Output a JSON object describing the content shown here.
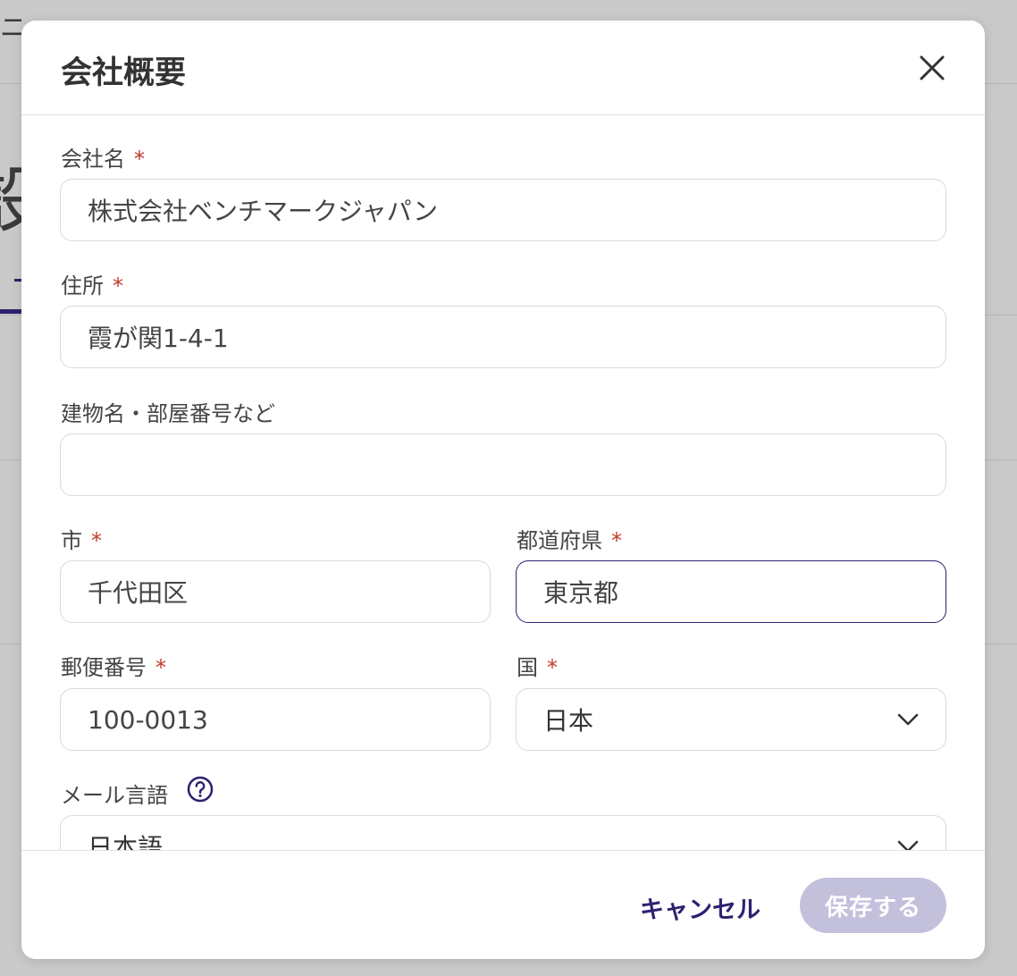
{
  "background": {
    "topbar_text": "ニールワーク",
    "big_glyph": "設"
  },
  "modal": {
    "title": "会社概要",
    "close_icon": "close-icon"
  },
  "form": {
    "company_name": {
      "label": "会社名",
      "required_mark": "*",
      "value": "株式会社ベンチマークジャパン"
    },
    "address": {
      "label": "住所",
      "required_mark": "*",
      "value": "霞が関1-4-1"
    },
    "building": {
      "label": "建物名・部屋番号など",
      "value": ""
    },
    "city": {
      "label": "市",
      "required_mark": "*",
      "value": "千代田区"
    },
    "prefecture": {
      "label": "都道府県",
      "required_mark": "*",
      "value": "東京都"
    },
    "postal_code": {
      "label": "郵便番号",
      "required_mark": "*",
      "value": "100-0013"
    },
    "country": {
      "label": "国",
      "required_mark": "*",
      "value": "日本"
    },
    "email_language": {
      "label": "メール言語",
      "value": "日本語",
      "help_icon": "question-circle-icon"
    }
  },
  "footer": {
    "cancel_label": "キャンセル",
    "save_label": "保存する"
  },
  "colors": {
    "accent": "#2d2170",
    "required": "#c0392b",
    "save_disabled": "#c3c0dc",
    "overlay": "#c9c9c9"
  }
}
